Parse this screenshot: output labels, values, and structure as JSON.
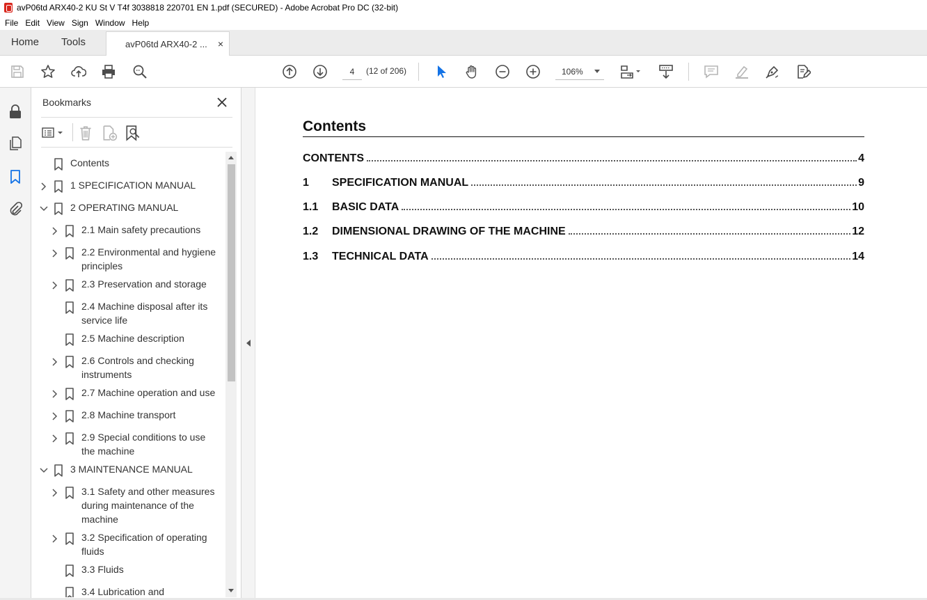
{
  "window": {
    "title": "avP06td ARX40-2 KU St V T4f 3038818 220701 EN 1.pdf (SECURED) - Adobe Acrobat Pro DC (32-bit)"
  },
  "menu": [
    "File",
    "Edit",
    "View",
    "Sign",
    "Window",
    "Help"
  ],
  "tabs": {
    "home": "Home",
    "tools": "Tools",
    "document": "avP06td ARX40-2 ...",
    "close": "×"
  },
  "toolbar": {
    "page_number": "4",
    "page_count": "(12 of 206)",
    "zoom": "106%"
  },
  "bookmarks_panel": {
    "title": "Bookmarks",
    "items": [
      {
        "label": "Contents",
        "level": 0,
        "expander": "none"
      },
      {
        "label": "1 SPECIFICATION MANUAL",
        "level": 0,
        "expander": "collapsed"
      },
      {
        "label": "2 OPERATING MANUAL",
        "level": 0,
        "expander": "expanded"
      },
      {
        "label": "2.1 Main safety precautions",
        "level": 1,
        "expander": "collapsed"
      },
      {
        "label": "2.2 Environmental and hygiene",
        "label2": "principles",
        "level": 1,
        "expander": "collapsed"
      },
      {
        "label": "2.3 Preservation and storage",
        "level": 1,
        "expander": "collapsed"
      },
      {
        "label": "2.4 Machine disposal after its",
        "label2": "service life",
        "level": 1,
        "expander": "none"
      },
      {
        "label": "2.5 Machine description",
        "level": 1,
        "expander": "none"
      },
      {
        "label": "2.6 Controls and checking",
        "label2": "instruments",
        "level": 1,
        "expander": "collapsed"
      },
      {
        "label": "2.7 Machine operation and use",
        "level": 1,
        "expander": "collapsed"
      },
      {
        "label": "2.8 Machine transport",
        "level": 1,
        "expander": "collapsed"
      },
      {
        "label": "2.9 Special conditions to use",
        "label2": "the machine",
        "level": 1,
        "expander": "collapsed"
      },
      {
        "label": "3 MAINTENANCE MANUAL",
        "level": 0,
        "expander": "expanded"
      },
      {
        "label": "3.1 Safety and other measures",
        "label2": "during maintenance of the",
        "label3": "machine",
        "level": 1,
        "expander": "collapsed"
      },
      {
        "label": "3.2 Specification of operating",
        "label2": "fluids",
        "level": 1,
        "expander": "collapsed"
      },
      {
        "label": "3.3 Fluids",
        "level": 1,
        "expander": "none"
      },
      {
        "label": "3.4 Lubrication and",
        "level": 1,
        "expander": "none"
      }
    ]
  },
  "document": {
    "heading": "Contents",
    "toc": [
      {
        "num": "",
        "title": "CONTENTS",
        "page": "4"
      },
      {
        "num": "1",
        "title": "SPECIFICATION MANUAL",
        "page": "9"
      },
      {
        "num": "1.1",
        "title": "BASIC DATA",
        "page": "10"
      },
      {
        "num": "1.2",
        "title": "DIMENSIONAL DRAWING OF THE MACHINE",
        "page": "12"
      },
      {
        "num": "1.3",
        "title": "TECHNICAL DATA",
        "page": "14"
      }
    ]
  },
  "colors": {
    "accent": "#1473e6",
    "pdf_red": "#d9261c",
    "icon_gray": "#4b4b4b",
    "disabled_gray": "#b5b5b5"
  }
}
